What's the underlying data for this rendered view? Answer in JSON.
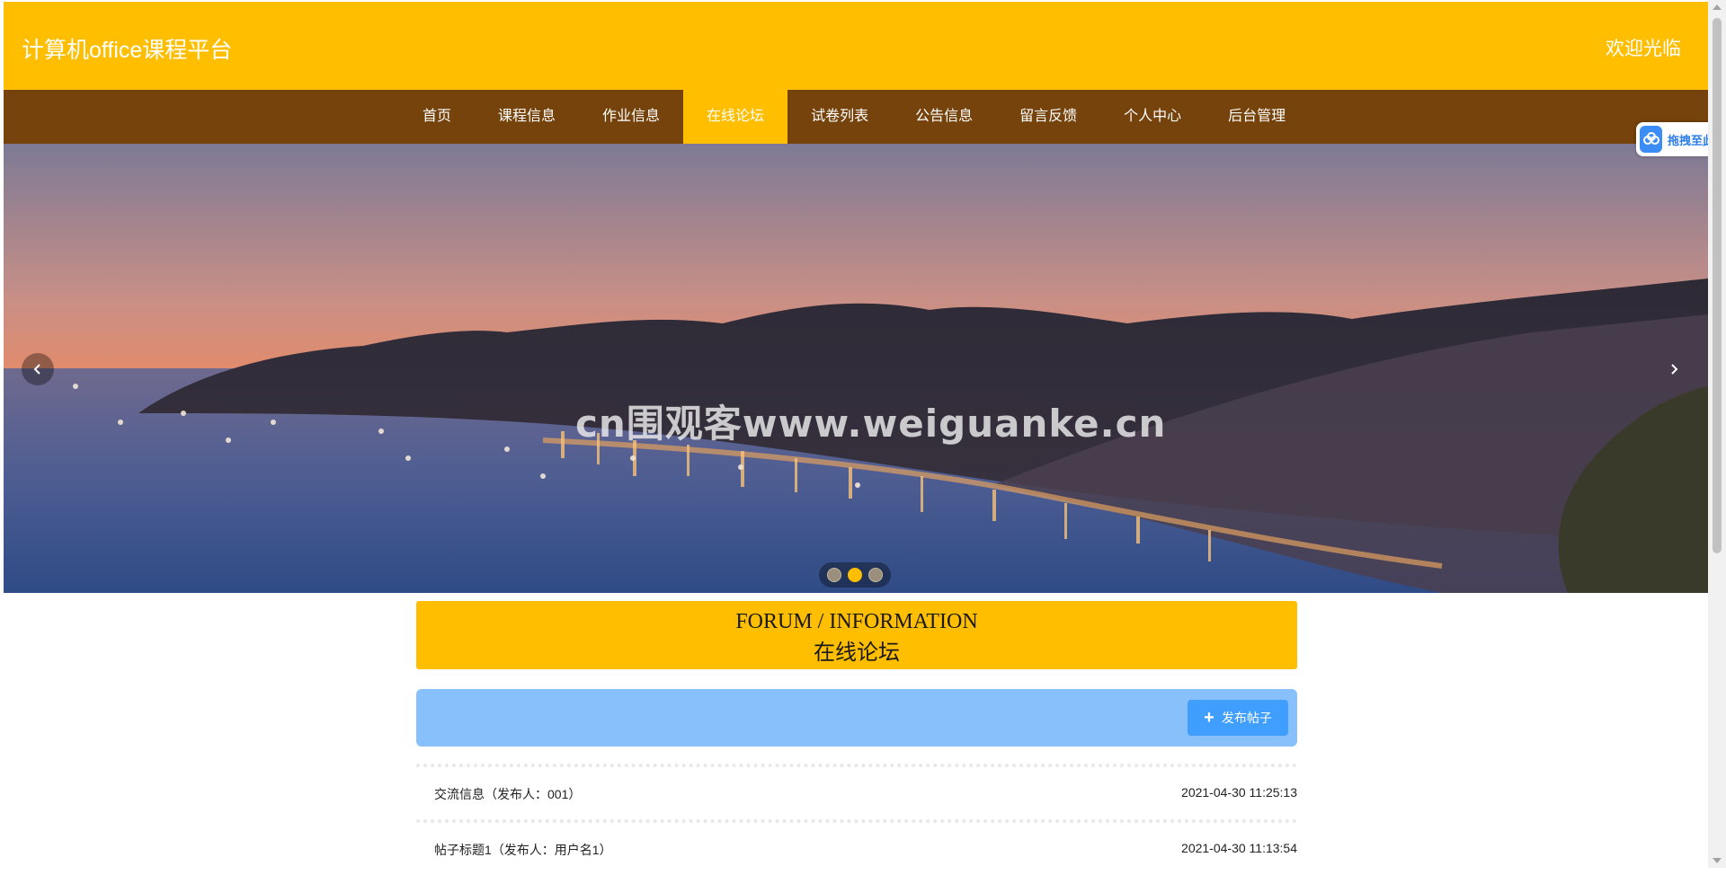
{
  "header": {
    "site_title": "计算机office课程平台",
    "welcome": "欢迎光临",
    "background_color": "#ffbe00"
  },
  "nav": {
    "background_color": "#75430b",
    "items": [
      {
        "label": "首页",
        "active": false
      },
      {
        "label": "课程信息",
        "active": false
      },
      {
        "label": "作业信息",
        "active": false
      },
      {
        "label": "在线论坛",
        "active": true
      },
      {
        "label": "试卷列表",
        "active": false
      },
      {
        "label": "公告信息",
        "active": false
      },
      {
        "label": "留言反馈",
        "active": false
      },
      {
        "label": "个人中心",
        "active": false
      },
      {
        "label": "后台管理",
        "active": false
      }
    ]
  },
  "banner": {
    "watermark": "cn围观客www.weiguanke.cn",
    "prev_icon": "chevron-left-icon",
    "next_icon": "chevron-right-icon",
    "slide_count": 3,
    "active_slide": 2
  },
  "section": {
    "title_en": "FORUM / INFORMATION",
    "title_cn": "在线论坛"
  },
  "toolbar": {
    "publish_label": "发布帖子",
    "publish_icon": "plus-icon",
    "background_color": "#88c0fb",
    "button_color": "#409eff"
  },
  "posts": [
    {
      "title": "交流信息（发布人：001）",
      "time": "2021-04-30 11:25:13"
    },
    {
      "title": "帖子标题1（发布人：用户名1）",
      "time": "2021-04-30 11:13:54"
    }
  ],
  "side_widget": {
    "label": "拖拽至此上传",
    "icon": "cloud-upload-icon"
  }
}
